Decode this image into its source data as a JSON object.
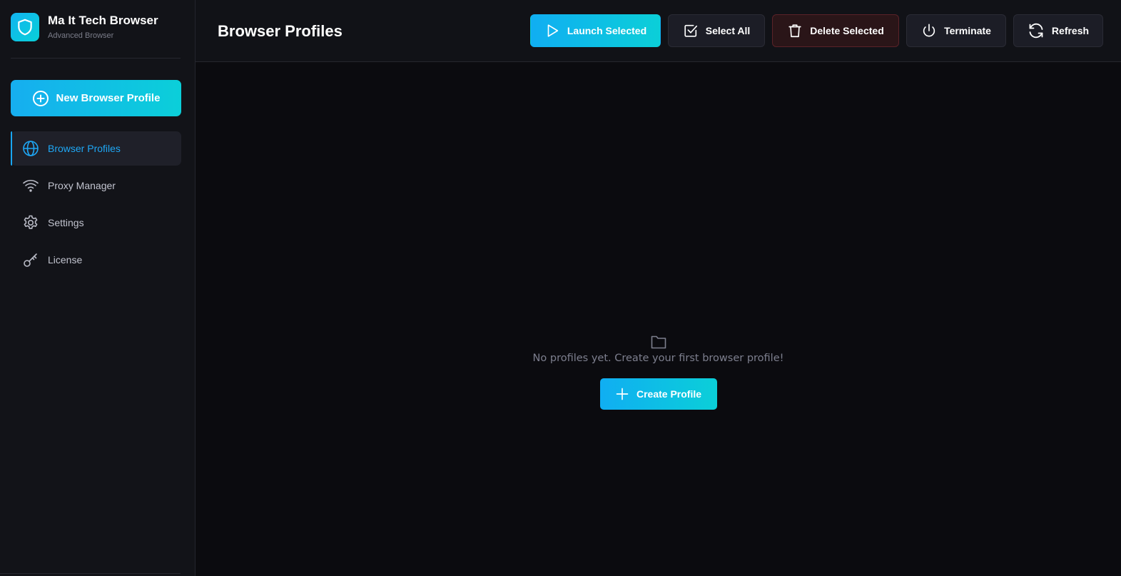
{
  "app": {
    "title": "Ma It Tech Browser",
    "subtitle": "Advanced Browser",
    "logo_icon": "shield-icon"
  },
  "sidebar": {
    "new_profile_label": "New Browser Profile",
    "items": [
      {
        "label": "Browser Profiles",
        "icon": "globe-icon",
        "active": true
      },
      {
        "label": "Proxy Manager",
        "icon": "wifi-icon",
        "active": false
      },
      {
        "label": "Settings",
        "icon": "gear-icon",
        "active": false
      },
      {
        "label": "License",
        "icon": "key-icon",
        "active": false
      }
    ]
  },
  "header": {
    "title": "Browser Profiles",
    "actions": {
      "launch": "Launch Selected",
      "select_all": "Select All",
      "delete": "Delete Selected",
      "terminate": "Terminate",
      "refresh": "Refresh"
    }
  },
  "empty_state": {
    "icon": "folder-icon",
    "message": "No profiles yet. Create your first browser profile!",
    "create_label": "Create Profile"
  },
  "colors": {
    "accent": "#12aef0",
    "accent_end": "#0bcfd8",
    "active_nav": "#1ea7f5",
    "delete_bg": "#2a1518",
    "delete_border": "#5a2228",
    "background": "#0b0b0f",
    "sidebar_bg": "#121318"
  }
}
